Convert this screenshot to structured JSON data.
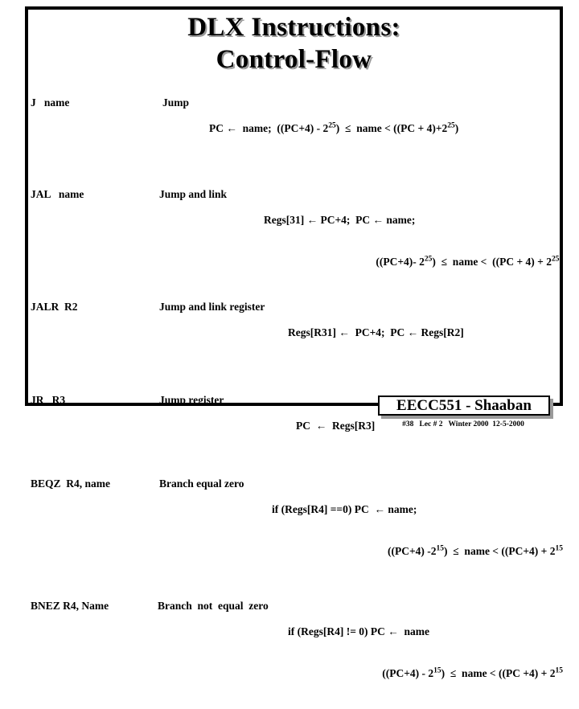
{
  "slide": {
    "title_line1": "DLX Instructions:",
    "title_line2": "Control-Flow",
    "title_shadow_color": "#9a9a9a",
    "frame_color": "#000000",
    "background_color": "#ffffff"
  },
  "instructions": [
    {
      "mnemonic": "J   name",
      "meaning": "Jump",
      "operation_lines": [
        "PC ←  name;  ((PC+4) - 2²⁵) ≤  name < ((PC + 4)+2²⁵)"
      ]
    },
    {
      "mnemonic": "JAL   name",
      "meaning": "Jump and link",
      "operation_lines": [
        "Regs[31] ← PC+4;  PC ← name;",
        "((PC+4)- 2²⁵)  ≤  name <  ((PC + 4) + 2²⁵)"
      ]
    },
    {
      "mnemonic": "JALR  R2",
      "meaning": "Jump and link register",
      "operation_lines": [
        "Regs[R31] ←  PC+4;  PC ← Regs[R2]"
      ]
    },
    {
      "mnemonic": "JR   R3",
      "meaning": "Jump register",
      "operation_lines": [
        "PC  ←  Regs[R3]"
      ]
    },
    {
      "mnemonic": "BEQZ  R4, name",
      "meaning": "Branch equal zero",
      "operation_lines": [
        "if (Regs[R4] ==0) PC  ← name;",
        "((PC+4) -2¹⁵)  ≤  name < ((PC+4) + 2¹⁵"
      ]
    },
    {
      "mnemonic": "BNEZ R4, Name",
      "meaning": "Branch  not  equal  zero",
      "operation_lines": [
        "if (Regs[R4] != 0) PC ←  name",
        "((PC+4) - 2¹⁵)  ≤  name < ((PC +4) + 2¹⁵"
      ]
    }
  ],
  "rows": {
    "j": {
      "mnemonic": "J   name",
      "meaning": "Jump",
      "line1_a": "PC ",
      "line1_arrow": "←",
      "line1_b": "  name;  ((PC+4) - 2",
      "line1_sup1": "25",
      "line1_c": ")  ≤  name < ((PC + 4)+2",
      "line1_sup2": "25",
      "line1_d": ")"
    },
    "jal": {
      "mnemonic": "JAL   name",
      "meaning": "Jump and link",
      "line1": "Regs[31] ← PC+4;  PC ← name;",
      "line2_a": "((PC+4)- 2",
      "line2_sup1": "25",
      "line2_b": ")  ≤  name <  ((PC + 4) + 2",
      "line2_sup2": "25",
      "line2_c": ")"
    },
    "jalr": {
      "mnemonic": "JALR  R2",
      "meaning": "Jump and link register",
      "line1": "Regs[R31] ←  PC+4;  PC ← Regs[R2]"
    },
    "jr": {
      "mnemonic": "JR   R3",
      "meaning": "Jump register",
      "line1": "PC  ←  Regs[R3]"
    },
    "beqz": {
      "mnemonic": "BEQZ  R4, name",
      "meaning": "Branch equal zero",
      "line1": "if (Regs[R4] ==0) PC  ← name;",
      "line2_a": "((PC+4) -2",
      "line2_sup1": "15",
      "line2_b": ")  ≤  name < ((PC+4) + 2",
      "line2_sup2": "15"
    },
    "bnez": {
      "mnemonic": "BNEZ R4, Name",
      "meaning": "Branch  not  equal  zero",
      "line1": "if (Regs[R4] != 0) PC ←  name",
      "line2_a": "((PC+4) - 2",
      "line2_sup1": "15",
      "line2_b": ")  ≤  name < ((PC +4) + 2",
      "line2_sup2": "15"
    }
  },
  "footer": {
    "course": "EECC551 - Shaaban",
    "meta": "#38   Lec # 2   Winter 2000  12-5-2000",
    "slide_number": "#38",
    "lecture": "Lec # 2",
    "term": "Winter 2000",
    "date": "12-5-2000",
    "shadow_color": "#9a9a9a"
  }
}
